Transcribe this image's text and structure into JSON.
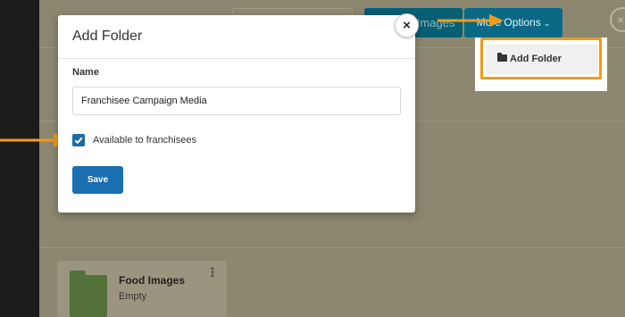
{
  "toolbar": {
    "upload_label": "Upload Images",
    "more_options_label": "More Options",
    "close_glyph": "×"
  },
  "dropdown": {
    "add_folder_label": "Add Folder"
  },
  "folders": [
    {
      "name": "Food Images",
      "status": "Empty",
      "menu_glyph": "⋮"
    }
  ],
  "modal": {
    "title": "Add Folder",
    "close_glyph": "×",
    "name_label": "Name",
    "name_value": "Franchisee Campaign Media",
    "checkbox_label": "Available to franchisees",
    "checkbox_checked": true,
    "save_label": "Save"
  },
  "colors": {
    "annotation_arrow": "#f29b18",
    "primary_button": "#1a6fb0",
    "overlay": "#8d8770"
  }
}
